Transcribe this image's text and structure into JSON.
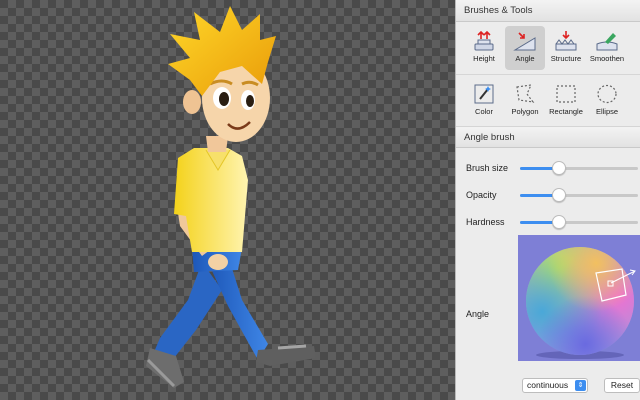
{
  "panel": {
    "tools_header": "Brushes & Tools",
    "tools_row1": [
      {
        "label": "Height",
        "icon": "height-brush-icon",
        "selected": false
      },
      {
        "label": "Angle",
        "icon": "angle-brush-icon",
        "selected": true
      },
      {
        "label": "Structure",
        "icon": "structure-brush-icon",
        "selected": false
      },
      {
        "label": "Smoothen",
        "icon": "smoothen-brush-icon",
        "selected": false
      }
    ],
    "tools_row2": [
      {
        "label": "Color",
        "icon": "magic-wand-icon"
      },
      {
        "label": "Polygon",
        "icon": "polygon-select-icon"
      },
      {
        "label": "Rectangle",
        "icon": "rectangle-select-icon"
      },
      {
        "label": "Ellipse",
        "icon": "ellipse-select-icon"
      }
    ],
    "brush_header": "Angle brush",
    "sliders": [
      {
        "label": "Brush size",
        "value": 0.33
      },
      {
        "label": "Opacity",
        "value": 0.33
      },
      {
        "label": "Hardness",
        "value": 0.33
      }
    ],
    "angle_label": "Angle",
    "mode_select": "continuous",
    "reset_label": "Reset"
  },
  "colors": {
    "accent": "#3d8ef0",
    "angle_background": "#7e7fd6"
  }
}
